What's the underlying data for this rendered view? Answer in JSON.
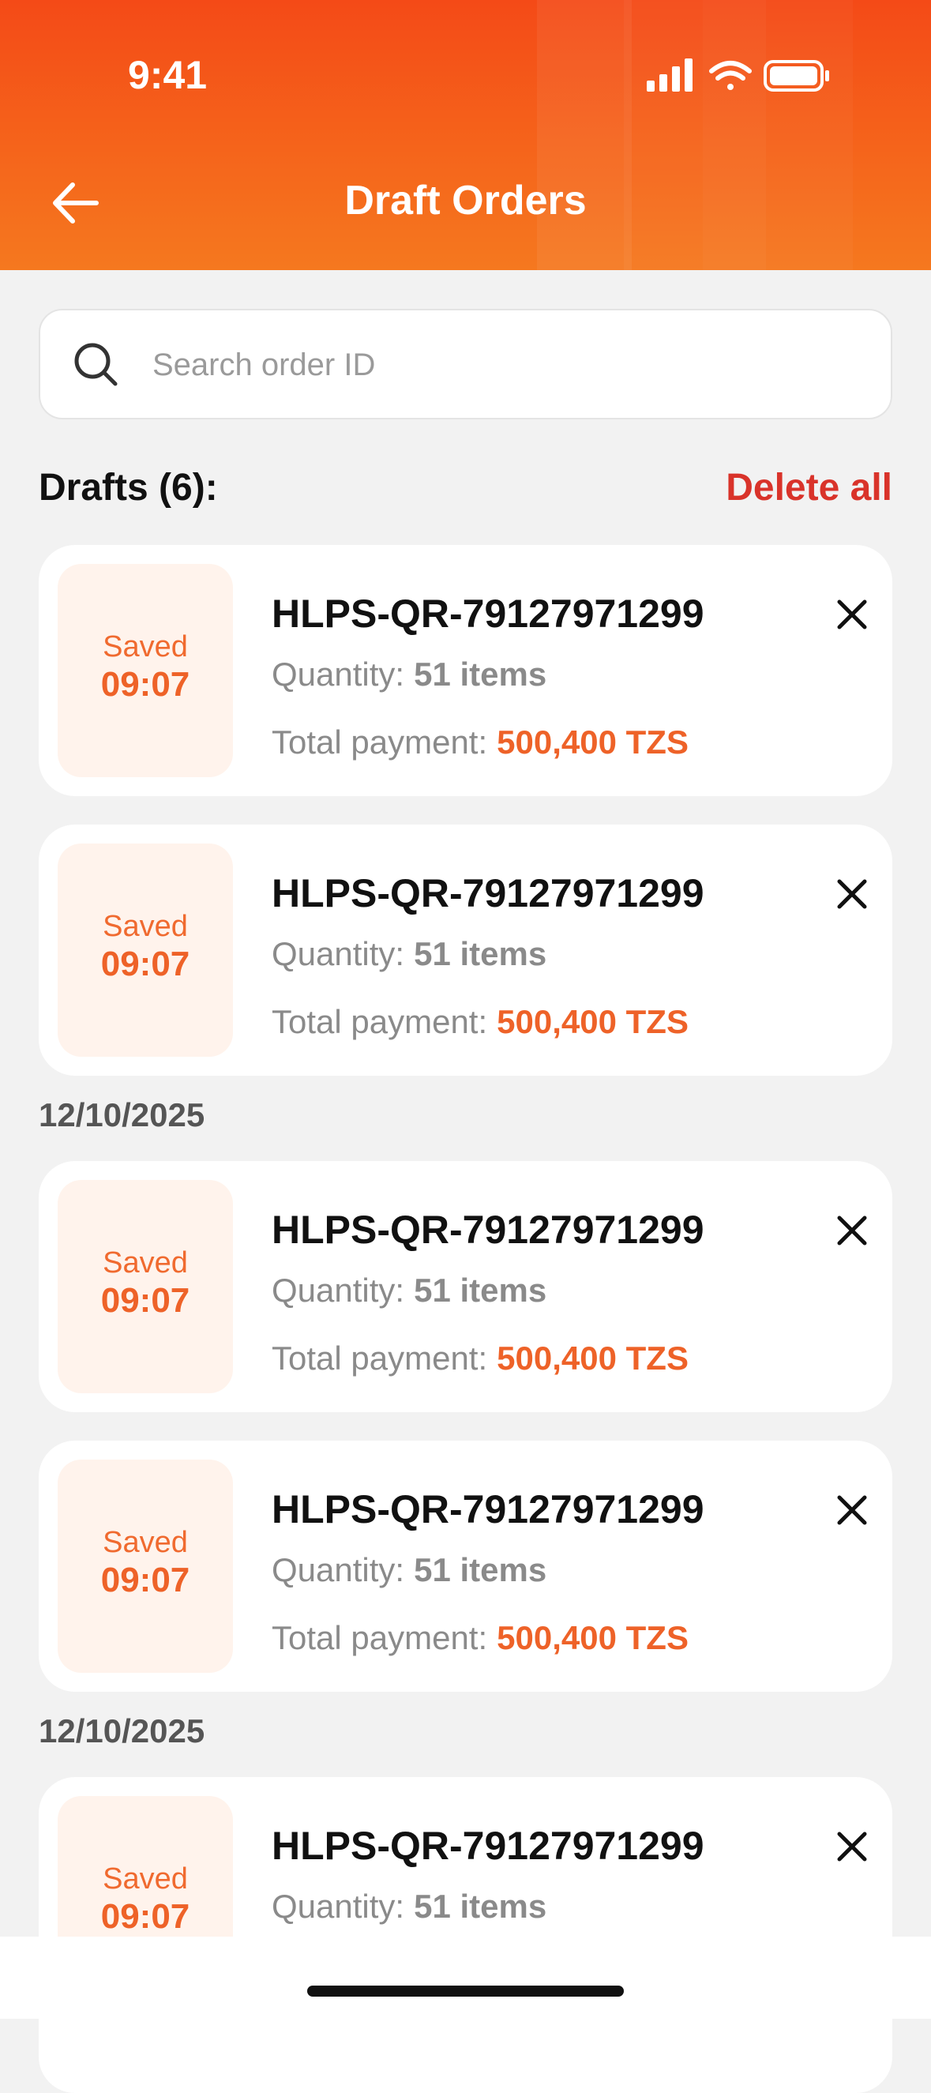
{
  "status_bar": {
    "time": "9:41"
  },
  "header": {
    "title": "Draft Orders"
  },
  "search": {
    "placeholder": "Search order ID"
  },
  "drafts": {
    "title": "Drafts (6):",
    "delete_all_label": "Delete all"
  },
  "date_labels": [
    "12/10/2025",
    "12/10/2025"
  ],
  "orders": [
    {
      "saved_label": "Saved",
      "saved_time": "09:07",
      "order_id": "HLPS-QR-79127971299",
      "quantity_label": "Quantity:",
      "quantity_value": "51 items",
      "payment_label": "Total payment:",
      "payment_value": "500,400 TZS"
    },
    {
      "saved_label": "Saved",
      "saved_time": "09:07",
      "order_id": "HLPS-QR-79127971299",
      "quantity_label": "Quantity:",
      "quantity_value": "51 items",
      "payment_label": "Total payment:",
      "payment_value": "500,400 TZS"
    },
    {
      "saved_label": "Saved",
      "saved_time": "09:07",
      "order_id": "HLPS-QR-79127971299",
      "quantity_label": "Quantity:",
      "quantity_value": "51 items",
      "payment_label": "Total payment:",
      "payment_value": "500,400 TZS"
    },
    {
      "saved_label": "Saved",
      "saved_time": "09:07",
      "order_id": "HLPS-QR-79127971299",
      "quantity_label": "Quantity:",
      "quantity_value": "51 items",
      "payment_label": "Total payment:",
      "payment_value": "500,400 TZS"
    },
    {
      "saved_label": "Saved",
      "saved_time": "09:07",
      "order_id": "HLPS-QR-79127971299",
      "quantity_label": "Quantity:",
      "quantity_value": "51 items"
    }
  ],
  "colors": {
    "brand": "#f5641b",
    "accent": "#ee6228",
    "danger": "#d9332a"
  }
}
